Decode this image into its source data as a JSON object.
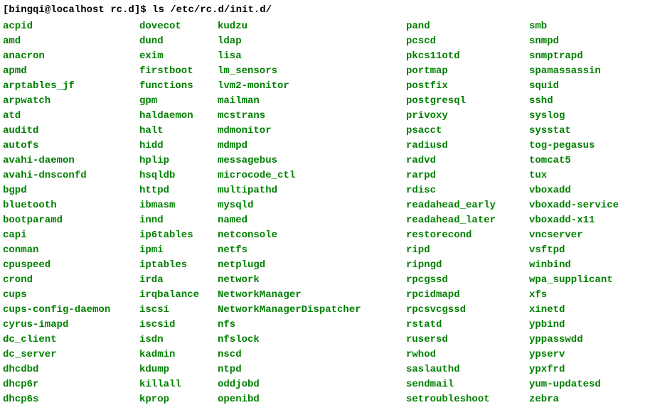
{
  "prompt": {
    "user_host": "[bingqi@localhost rc.d]$ ",
    "command": "ls /etc/rc.d/init.d/"
  },
  "columns": [
    [
      "acpid",
      "amd",
      "anacron",
      "apmd",
      "arptables_jf",
      "arpwatch",
      "atd",
      "auditd",
      "autofs",
      "avahi-daemon",
      "avahi-dnsconfd",
      "bgpd",
      "bluetooth",
      "bootparamd",
      "capi",
      "conman",
      "cpuspeed",
      "crond",
      "cups",
      "cups-config-daemon",
      "cyrus-imapd",
      "dc_client",
      "dc_server",
      "dhcdbd",
      "dhcp6r",
      "dhcp6s"
    ],
    [
      "dovecot",
      "dund",
      "exim",
      "firstboot",
      "functions",
      "gpm",
      "haldaemon",
      "halt",
      "hidd",
      "hplip",
      "hsqldb",
      "httpd",
      "ibmasm",
      "innd",
      "ip6tables",
      "ipmi",
      "iptables",
      "irda",
      "irqbalance",
      "iscsi",
      "iscsid",
      "isdn",
      "kadmin",
      "kdump",
      "killall",
      "kprop"
    ],
    [
      "kudzu",
      "ldap",
      "lisa",
      "lm_sensors",
      "lvm2-monitor",
      "mailman",
      "mcstrans",
      "mdmonitor",
      "mdmpd",
      "messagebus",
      "microcode_ctl",
      "multipathd",
      "mysqld",
      "named",
      "netconsole",
      "netfs",
      "netplugd",
      "network",
      "NetworkManager",
      "NetworkManagerDispatcher",
      "nfs",
      "nfslock",
      "nscd",
      "ntpd",
      "oddjobd",
      "openibd"
    ],
    [
      "pand",
      "pcscd",
      "pkcs11otd",
      "portmap",
      "postfix",
      "postgresql",
      "privoxy",
      "psacct",
      "radiusd",
      "radvd",
      "rarpd",
      "rdisc",
      "readahead_early",
      "readahead_later",
      "restorecond",
      "ripd",
      "ripngd",
      "rpcgssd",
      "rpcidmapd",
      "rpcsvcgssd",
      "rstatd",
      "rusersd",
      "rwhod",
      "saslauthd",
      "sendmail",
      "setroubleshoot"
    ],
    [
      "smb",
      "snmpd",
      "snmptrapd",
      "spamassassin",
      "squid",
      "sshd",
      "syslog",
      "sysstat",
      "tog-pegasus",
      "tomcat5",
      "tux",
      "vboxadd",
      "vboxadd-service",
      "vboxadd-x11",
      "vncserver",
      "vsftpd",
      "winbind",
      "wpa_supplicant",
      "xfs",
      "xinetd",
      "ypbind",
      "yppasswdd",
      "ypserv",
      "ypxfrd",
      "yum-updatesd",
      "zebra"
    ]
  ]
}
